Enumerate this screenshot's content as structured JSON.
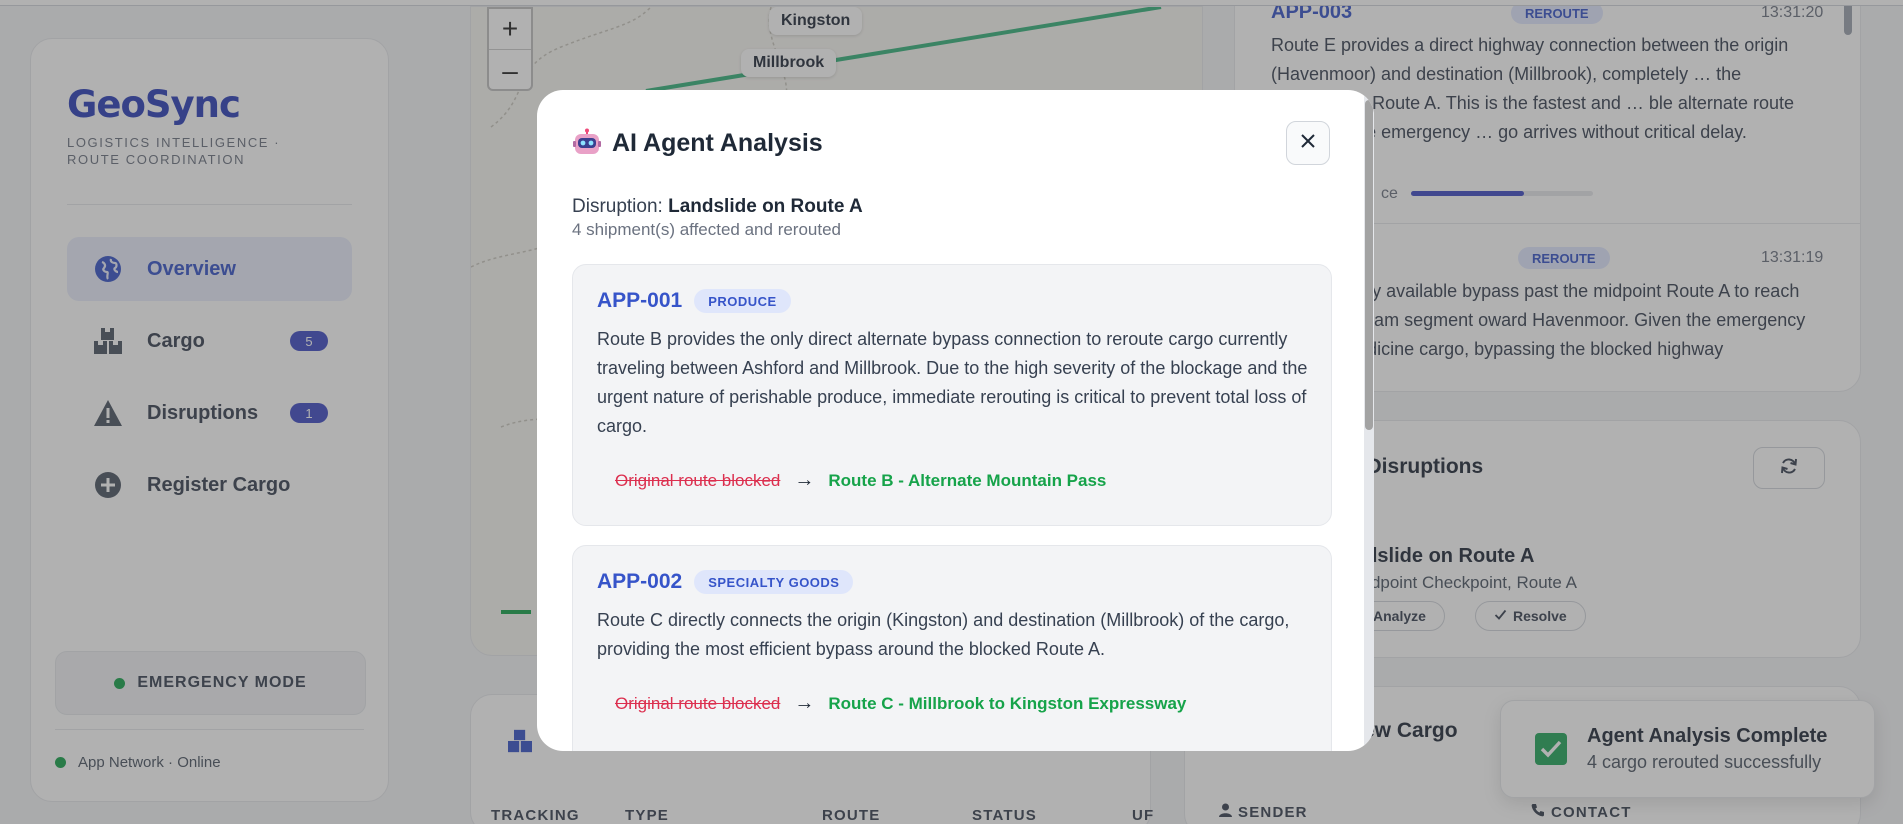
{
  "app": {
    "logo": "GeoSync",
    "tagline": "LOGISTICS INTELLIGENCE · ROUTE COORDINATION"
  },
  "sidebar": {
    "items": [
      {
        "label": "Overview",
        "icon": "globe-icon",
        "active": true
      },
      {
        "label": "Cargo",
        "icon": "boxes-icon",
        "badge": "5"
      },
      {
        "label": "Disruptions",
        "icon": "warning-icon",
        "badge": "1"
      },
      {
        "label": "Register Cargo",
        "icon": "plus-circle-icon"
      }
    ],
    "emergency_label": "EMERGENCY MODE",
    "network_status": "App Network · Online"
  },
  "map": {
    "places": [
      "Kingston",
      "Millbrook"
    ],
    "zoom_in": "+",
    "zoom_out": "–"
  },
  "feed": {
    "entries": [
      {
        "id": "APP-003",
        "badge": "REROUTE",
        "time": "13:31:20",
        "text": "Route E provides a direct highway connection between the origin (Havenmoor) and destination (Millbrook), completely … the landslide on Route A. This is the fastest and … ble alternate route to ensure the emergency … go arrives without critical delay.",
        "confidence_label": "ce",
        "confidence": 0.62
      },
      {
        "badge": "REROUTE",
        "time": "13:31:19",
        "text": "vides the only available bypass past the midpoint Route A to reach the downstream segment oward Havenmoor. Given the emergency nature of nedicine cargo, bypassing the blocked highway"
      }
    ]
  },
  "disruptions_panel": {
    "title": "e Disruptions",
    "item_title": "ndslide on Route A",
    "item_location": "Midpoint Checkpoint, Route A",
    "analyze_label": "Analyze",
    "resolve_label": "Resolve"
  },
  "new_cargo_panel": {
    "title": "ew Cargo",
    "sender_label": "SENDER",
    "contact_label": "CONTACT"
  },
  "cargo_table": {
    "headers": [
      "TRACKING",
      "TYPE",
      "ROUTE",
      "STATUS",
      "UF"
    ]
  },
  "modal": {
    "title": "AI Agent Analysis",
    "disruption_prefix": "Disruption:",
    "disruption_name": "Landslide on Route A",
    "affected": "4 shipment(s) affected and rerouted",
    "cards": [
      {
        "id": "APP-001",
        "badge": "PRODUCE",
        "text": "Route B provides the only direct alternate bypass connection to reroute cargo currently traveling between Ashford and Millbrook. Due to the high severity of the blockage and the urgent nature of perishable produce, immediate rerouting is critical to prevent total loss of cargo.",
        "old_route": "Original route blocked",
        "new_route": "Route B - Alternate Mountain Pass"
      },
      {
        "id": "APP-002",
        "badge": "SPECIALTY GOODS",
        "text": "Route C directly connects the origin (Kingston) and destination (Millbrook) of the cargo, providing the most efficient bypass around the blocked Route A.",
        "old_route": "Original route blocked",
        "new_route": "Route C - Millbrook to Kingston Expressway"
      }
    ],
    "arrow": "→"
  },
  "toast": {
    "title": "Agent Analysis Complete",
    "subtitle": "4 cargo rerouted successfully"
  },
  "colors": {
    "brand": "#2b3fb8",
    "accent": "#3654c9",
    "success": "#16a34a",
    "danger": "#dc2f4f"
  }
}
